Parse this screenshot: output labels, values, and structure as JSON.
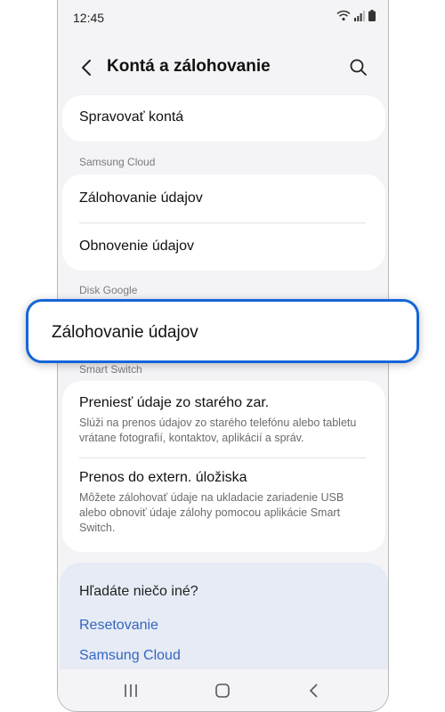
{
  "status_bar": {
    "time": "12:45"
  },
  "header": {
    "title": "Kontá a zálohovanie"
  },
  "accounts": {
    "manage_label": "Spravovať kontá"
  },
  "samsung_cloud": {
    "section_label": "Samsung Cloud",
    "backup_label": "Zálohovanie údajov",
    "restore_label": "Obnovenie údajov"
  },
  "google_drive": {
    "section_label": "Disk Google",
    "backup_label": "Zálohovanie údajov"
  },
  "smart_switch": {
    "section_label": "Smart Switch",
    "items": [
      {
        "title": "Preniesť údaje zo starého zar.",
        "description": "Slúži na prenos údajov zo starého telefónu alebo tabletu vrátane fotografií, kontaktov, aplikácií a správ."
      },
      {
        "title": "Prenos do extern. úložiska",
        "description": "Môžete zálohovať údaje na ukladacie zariadenie USB alebo obnoviť údaje zálohy pomocou aplikácie Smart Switch."
      }
    ]
  },
  "help": {
    "title": "Hľadáte niečo iné?",
    "links": [
      "Resetovanie",
      "Samsung Cloud"
    ]
  },
  "colors": {
    "highlight_border": "#1565d8",
    "link": "#3565c0",
    "help_bg": "#e6ebf5"
  },
  "icons": {
    "back": "back-arrow-icon",
    "search": "search-icon",
    "wifi": "wifi-icon",
    "signal": "signal-icon",
    "battery": "battery-icon",
    "recents": "recents-icon",
    "home": "home-icon",
    "nav_back": "nav-back-icon"
  }
}
